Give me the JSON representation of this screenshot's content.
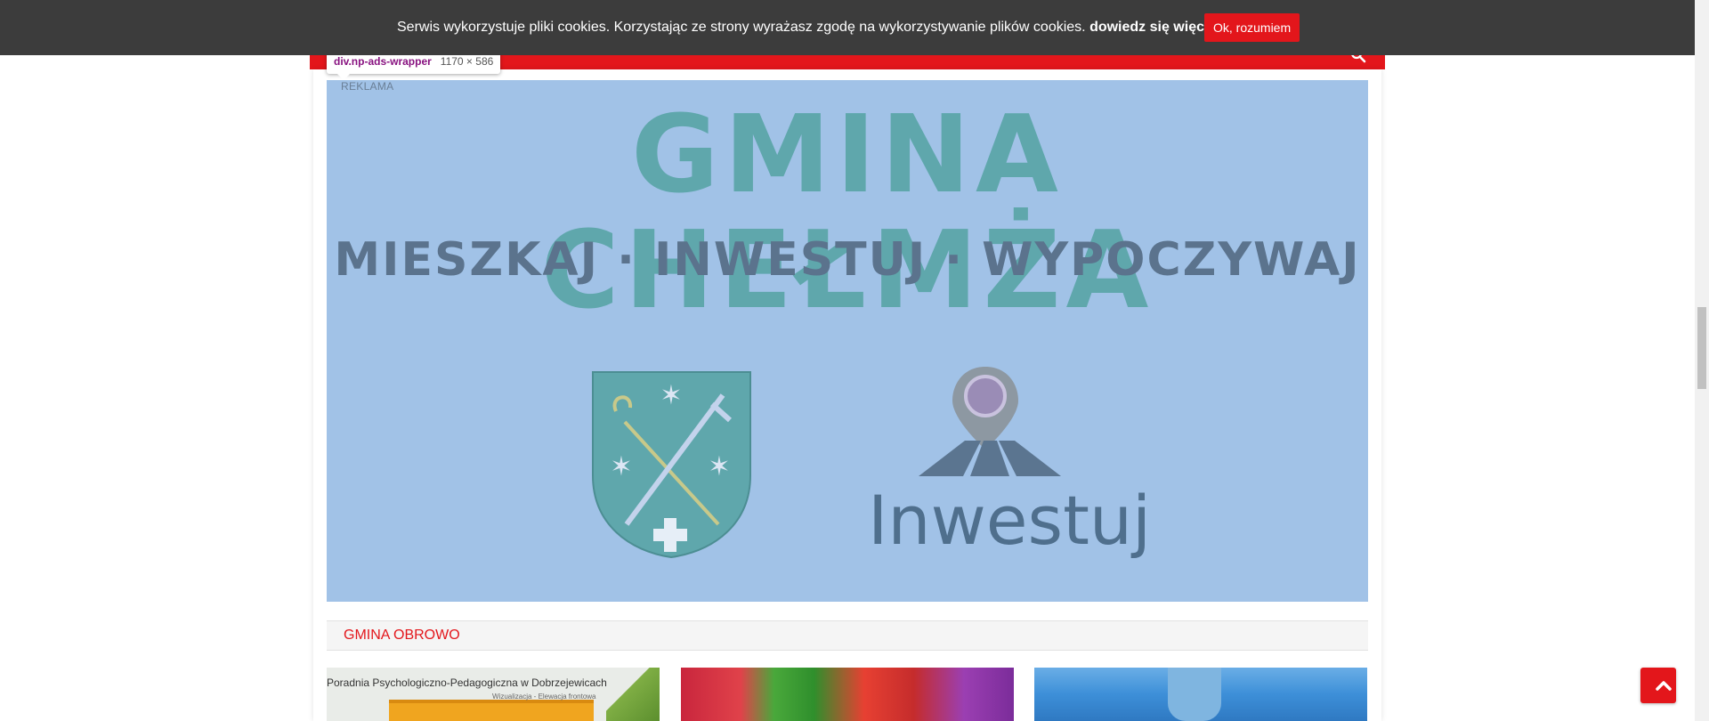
{
  "cookie_bar": {
    "message": "Serwis wykorzystuje pliki cookies. Korzystając ze strony wyrażasz zgodę na wykorzystywanie plików cookies.",
    "link_text": "dowiedz się więcej",
    "link_suffix": ".",
    "button_label": "Ok, rozumiem"
  },
  "devtools": {
    "selector": "div.np-ads-wrapper",
    "dimensions": "1170 × 586"
  },
  "ad": {
    "label": "REKLAMA",
    "title": "GMINA CHEŁMŻA",
    "tagline": "MIESZKAJ · INWESTUJ · WYPOCZYWAJ",
    "invest_text": "Inwestuj"
  },
  "section": {
    "title": "GMINA OBROWO"
  },
  "articles": [
    {
      "caption": "Poradnia Psychologiczno-Pedagogiczna w Dobrzejewicach",
      "subcaption": "Wizualizacja - Elewacja frontowa"
    },
    {
      "caption": ""
    },
    {
      "caption": ""
    }
  ],
  "colors": {
    "brand_red": "#e3161b",
    "cookie_bg": "#3c3c3c",
    "ad_bg": "#a1c2e7",
    "ad_title": "#5fa7ac",
    "ad_tagline": "#5b738d"
  },
  "icons": {
    "search": "search-icon",
    "scroll_top": "chevron-up-icon"
  }
}
